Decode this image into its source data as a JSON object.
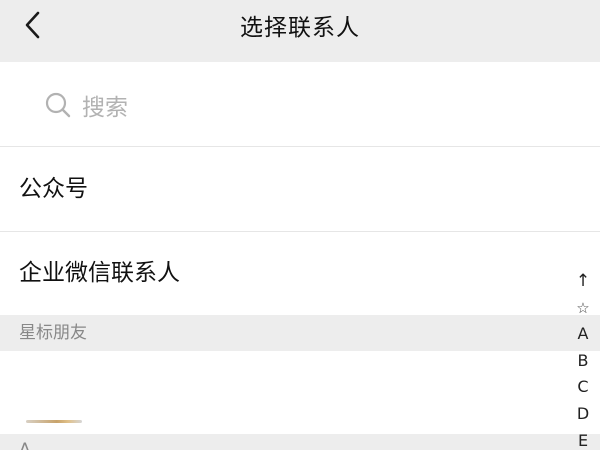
{
  "nav": {
    "back_icon": "chevron-left-icon",
    "title": "选择联系人"
  },
  "search": {
    "icon": "search-icon",
    "placeholder": "搜索"
  },
  "entries": [
    {
      "label": "公众号"
    },
    {
      "label": "企业微信联系人"
    }
  ],
  "sections": [
    {
      "label": "星标朋友"
    },
    {
      "label": "A"
    }
  ],
  "index_bar": [
    "↑",
    "☆",
    "A",
    "B",
    "C",
    "D",
    "E"
  ],
  "colors": {
    "background": "#ededed",
    "row_background": "#ffffff",
    "title_text": "#111111",
    "placeholder_text": "#b2b2b2",
    "section_text": "#888888"
  }
}
